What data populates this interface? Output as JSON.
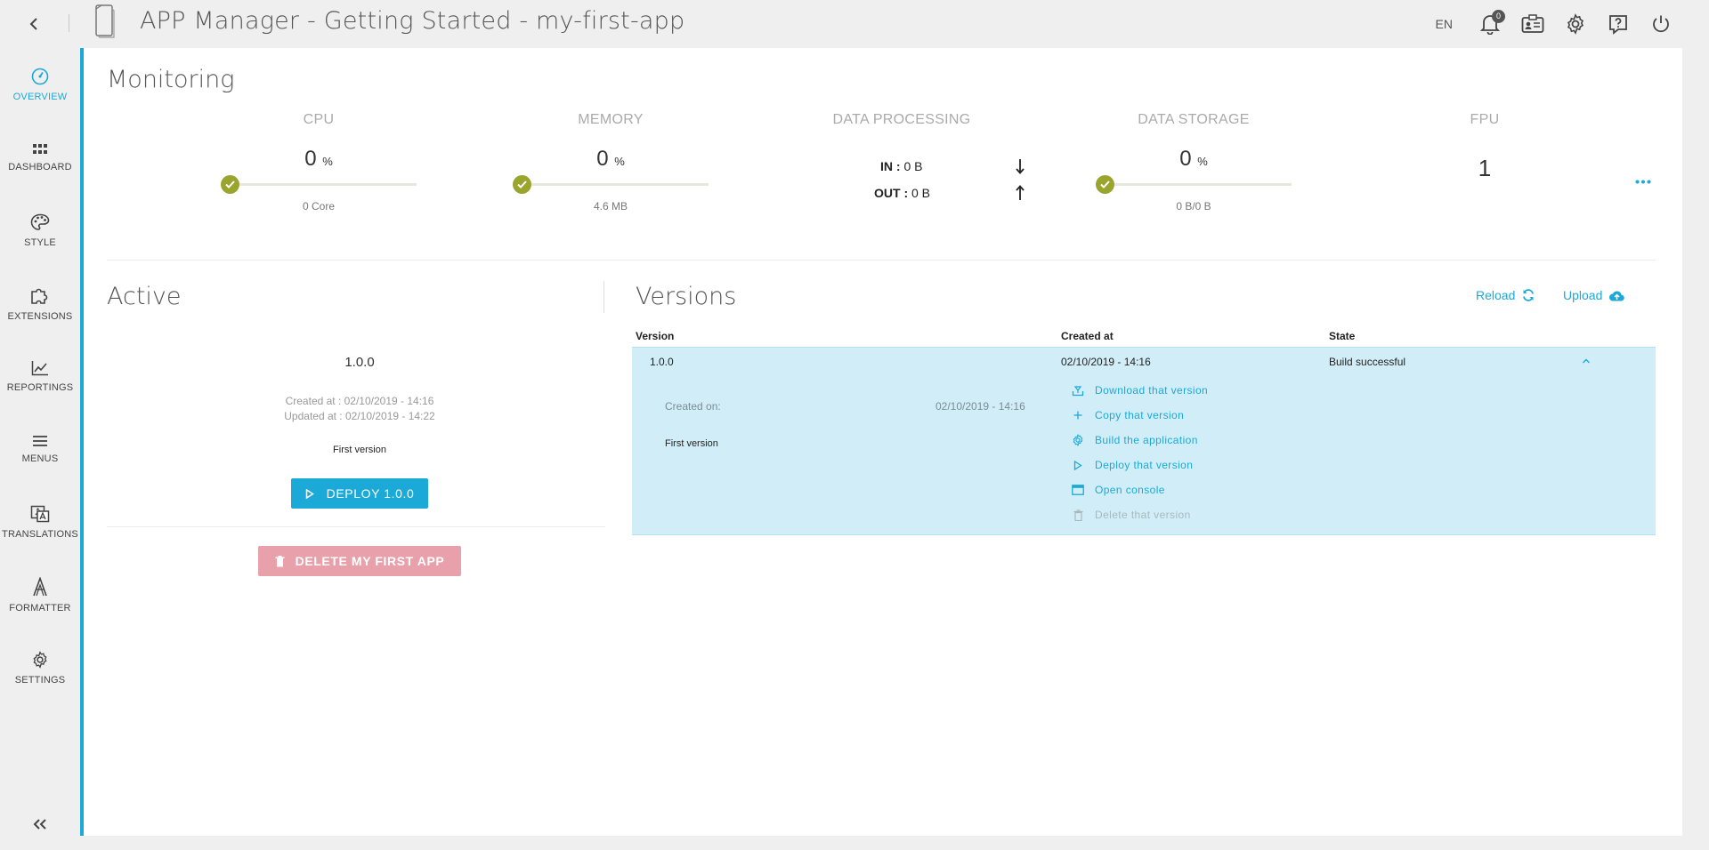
{
  "header": {
    "title": "APP Manager - Getting Started - my-first-app",
    "language": "EN",
    "notification_count": "0",
    "icons": [
      "chevron-left-icon",
      "tablet-icon",
      "bell-icon",
      "contact-card-icon",
      "gear-icon",
      "help-icon",
      "power-icon"
    ]
  },
  "sidebar": {
    "items": [
      {
        "label": "OVERVIEW",
        "icon": "speedometer-icon",
        "active": true
      },
      {
        "label": "DASHBOARD",
        "icon": "grid-icon",
        "active": false
      },
      {
        "label": "STYLE",
        "icon": "palette-icon",
        "active": false
      },
      {
        "label": "EXTENSIONS",
        "icon": "puzzle-icon",
        "active": false
      },
      {
        "label": "REPORTINGS",
        "icon": "line-chart-icon",
        "active": false
      },
      {
        "label": "MENUS",
        "icon": "menu-icon",
        "active": false
      },
      {
        "label": "TRANSLATIONS",
        "icon": "translate-icon",
        "active": false
      },
      {
        "label": "FORMATTER",
        "icon": "formatter-icon",
        "active": false
      },
      {
        "label": "SETTINGS",
        "icon": "gear-icon",
        "active": false
      }
    ],
    "collapse_icon": "double-chevron-left-icon"
  },
  "monitoring": {
    "title": "Monitoring",
    "cpu": {
      "label": "CPU",
      "value": "0",
      "unit": "%",
      "sub": "0 Core",
      "level": 0
    },
    "memory": {
      "label": "MEMORY",
      "value": "0",
      "unit": "%",
      "sub": "4.6 MB",
      "level": 0
    },
    "data_processing": {
      "label": "DATA PROCESSING",
      "in_label": "IN :",
      "in_value": "0 B",
      "out_label": "OUT :",
      "out_value": "0 B"
    },
    "data_storage": {
      "label": "DATA STORAGE",
      "value": "0",
      "unit": "%",
      "sub": "0 B/0 B",
      "level": 0
    },
    "fpu": {
      "label": "FPU",
      "value": "1"
    }
  },
  "active": {
    "title": "Active",
    "version": "1.0.0",
    "created_at": "Created at  : 02/10/2019 - 14:16",
    "updated_at": "Updated at : 02/10/2019 - 14:22",
    "description": "First version",
    "deploy_label": "DEPLOY 1.0.0",
    "delete_label": "DELETE MY FIRST APP"
  },
  "versions": {
    "title": "Versions",
    "reload_label": "Reload",
    "upload_label": "Upload",
    "columns": [
      "Version",
      "Created at",
      "State"
    ],
    "rows": [
      {
        "version": "1.0.0",
        "created_at": "02/10/2019 - 14:16",
        "state": "Build successful",
        "details": {
          "created_on_label": "Created on:",
          "created_on_value": "02/10/2019 - 14:16",
          "description": "First version"
        },
        "actions": [
          {
            "label": "Download that version",
            "icon": "download-icon",
            "enabled": true
          },
          {
            "label": "Copy that version",
            "icon": "plus-icon",
            "enabled": true
          },
          {
            "label": "Build the application",
            "icon": "gear-icon",
            "enabled": true
          },
          {
            "label": "Deploy that version",
            "icon": "play-icon",
            "enabled": true
          },
          {
            "label": "Open console",
            "icon": "console-icon",
            "enabled": true
          },
          {
            "label": "Delete that version",
            "icon": "trash-icon",
            "enabled": false
          }
        ]
      }
    ]
  },
  "colors": {
    "accent": "#1ba9d8",
    "gauge_ok": "#9aa52e",
    "danger_disabled": "#e8a0ab",
    "row_highlight": "#d1eef8"
  }
}
